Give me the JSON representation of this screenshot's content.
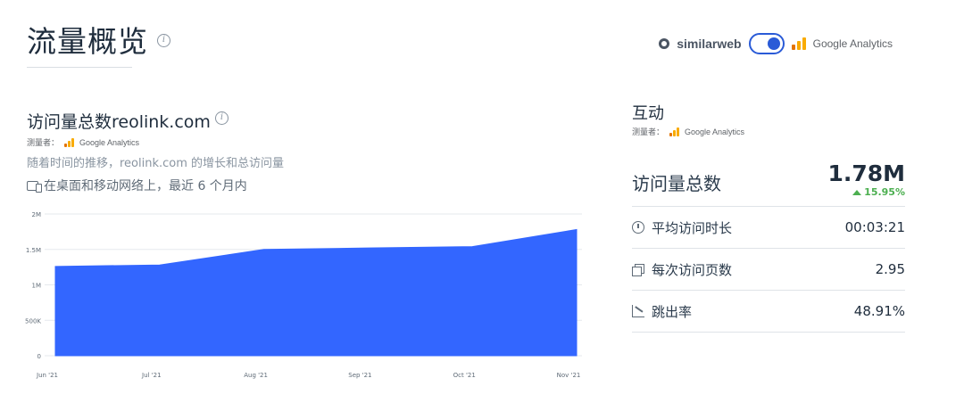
{
  "page": {
    "title": "流量概览",
    "info_icon": "i"
  },
  "source_switch": {
    "similarweb_label": "similarweb",
    "google_analytics_label": "Google Analytics",
    "selected": "Google Analytics"
  },
  "visits_section": {
    "title": "访问量总数reolink.com",
    "info_icon": "i",
    "measured_by_label": "测量者：",
    "measured_by_source": "Google Analytics",
    "subtitle": "随着时间的推移，reolink.com 的增长和总访问量",
    "scope": "在桌面和移动网络上，最近 6 个月内"
  },
  "chart_data": {
    "type": "area",
    "categories": [
      "Jun '21",
      "Jul '21",
      "Aug '21",
      "Sep '21",
      "Oct '21",
      "Nov '21"
    ],
    "series": [
      {
        "values": [
          1260000,
          1280000,
          1500000,
          1520000,
          1540000,
          1780000
        ],
        "color": "#3366ff"
      }
    ],
    "y_ticks": [
      "0",
      "500K",
      "1M",
      "1.5M",
      "2M"
    ],
    "ylim": [
      0,
      2000000
    ],
    "grid": true,
    "legend": "none"
  },
  "engagement": {
    "title": "互动",
    "measured_by_label": "测量者：",
    "measured_by_source": "Google Analytics",
    "total_visits_label": "访问量总数",
    "total_visits_value": "1.78M",
    "total_visits_change": "15.95%",
    "change_color": "#4caf50",
    "avg_duration_label": "平均访问时长",
    "avg_duration_value": "00:03:21",
    "pages_per_visit_label": "每次访问页数",
    "pages_per_visit_value": "2.95",
    "bounce_rate_label": "跳出率",
    "bounce_rate_value": "48.91%"
  }
}
